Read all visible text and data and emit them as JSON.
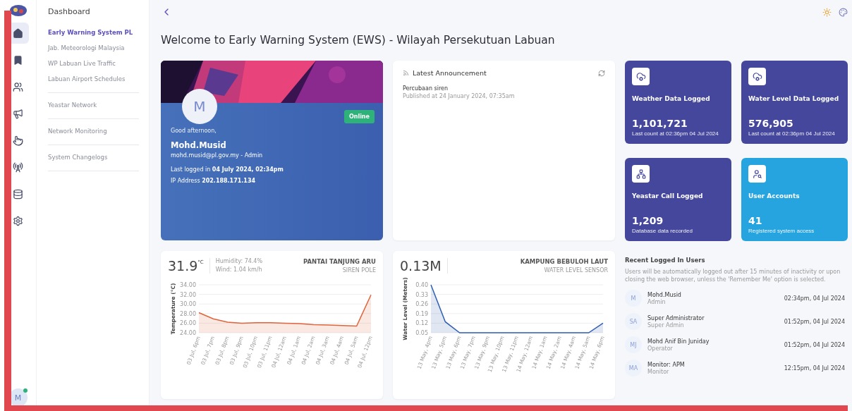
{
  "rail": {
    "items": [
      {
        "kind": "home",
        "selected": true
      },
      {
        "kind": "bookmark",
        "selected": false
      },
      {
        "kind": "users",
        "selected": false
      },
      {
        "kind": "megaphone",
        "selected": false
      },
      {
        "kind": "touch",
        "selected": false
      },
      {
        "kind": "antenna",
        "selected": false
      },
      {
        "kind": "database",
        "selected": false
      },
      {
        "kind": "settings",
        "selected": false
      }
    ],
    "avatar": {
      "initial": "M",
      "online": true
    }
  },
  "submenu": {
    "title": "Dashboard",
    "sections": [
      {
        "items": [
          {
            "label": "Early Warning System PL",
            "selected": true
          },
          {
            "label": "Jab. Meteorologi Malaysia",
            "selected": false
          },
          {
            "label": "WP Labuan Live Traffic",
            "selected": false
          },
          {
            "label": "Labuan Airport Schedules",
            "selected": false
          }
        ]
      },
      {
        "items": [
          {
            "label": "Yeastar Network",
            "selected": false
          }
        ]
      },
      {
        "items": [
          {
            "label": "Network Monitoring",
            "selected": false
          }
        ]
      },
      {
        "items": [
          {
            "label": "System Changelogs",
            "selected": false
          }
        ]
      }
    ]
  },
  "page_title": "Welcome to Early Warning System (EWS) - Wilayah Persekutuan Labuan",
  "profile": {
    "avatar_initial": "M",
    "status": "Online",
    "greeting": "Good afternoon,",
    "name": "Mohd.Musid",
    "email_role": "mohd.musid@pl.gov.my - Admin",
    "last_login": "Last logged in **04 July 2024, 02:34pm**",
    "ip": "IP Address **202.188.171.134**"
  },
  "announcement": {
    "title": "Latest Announcement",
    "items": [
      {
        "title": "Percubaan siren",
        "published": "Published at 24 January 2024, 07:35am"
      }
    ]
  },
  "stats": [
    {
      "kind": "cloud",
      "color": "#44479c",
      "label": "Weather Data Logged",
      "value": "1,101,721",
      "note": "Last count at 02:36pm 04 Jul 2024"
    },
    {
      "kind": "cloud",
      "color": "#44479c",
      "label": "Water Level Data Logged",
      "value": "576,905",
      "note": "Last count at 02:36pm 04 Jul 2024"
    },
    {
      "kind": "network",
      "color": "#44479c",
      "label": "Yeastar Call Logged",
      "value": "1,209",
      "note": "Database data recorded"
    },
    {
      "kind": "user",
      "color": "#26a4e0",
      "label": "User Accounts",
      "value": "41",
      "note": "Registered system access"
    }
  ],
  "weather": {
    "reading": "31.9",
    "unit": "°C",
    "humidity": "Humidity: 74.4%",
    "wind": "Wind: 1.04 km/h",
    "station": "PANTAI TANJUNG ARU",
    "type": "SIREN POLE",
    "chart_data": {
      "type": "area",
      "ylabel": "Temperature (°C)",
      "categories": [
        "03 Jul, 6pm",
        "03 Jul, 7pm",
        "03 Jul, 8pm",
        "03 Jul, 9pm",
        "03 Jul, 10pm",
        "03 Jul, 11pm",
        "04 Jul, 12am",
        "04 Jul, 1am",
        "04 Jul, 2am",
        "04 Jul, 3am",
        "04 Jul, 4am",
        "04 Jul, 5am",
        "04 Jul, 12pm"
      ],
      "grid": true,
      "series": [
        {
          "color": "#e0643c",
          "values": [
            28.2,
            26.9,
            26.2,
            26.0,
            26.1,
            26.1,
            26.0,
            25.9,
            25.7,
            25.6,
            25.5,
            25.4,
            31.9
          ]
        }
      ],
      "ylim": [
        24,
        34
      ],
      "yticks": [
        {
          "value": 24,
          "label": "24.00"
        },
        {
          "value": 26,
          "label": "26.00"
        },
        {
          "value": 28,
          "label": "28.00"
        },
        {
          "value": 30,
          "label": "30.00"
        },
        {
          "value": 32,
          "label": "32.00"
        },
        {
          "value": 34,
          "label": "34.00"
        }
      ]
    }
  },
  "water": {
    "reading": "0.13M",
    "station": "KAMPUNG BEBULOH LAUT",
    "type": "WATER LEVEL SENSOR",
    "chart_data": {
      "type": "area",
      "ylabel": "Water Level (Meters)",
      "categories": [
        "13 May, 4pm",
        "13 May, 5pm",
        "13 May, 6pm",
        "13 May, 7pm",
        "13 May, 9pm",
        "13 May, 10pm",
        "13 May, 11pm",
        "14 May, 12am",
        "14 May, 1am",
        "14 May, 2am",
        "14 May, 4am",
        "14 May, 5am",
        "14 May, 6pm"
      ],
      "grid": true,
      "series": [
        {
          "color": "#2f5fb0",
          "values": [
            0.4,
            0.13,
            0.05,
            0.05,
            0.05,
            0.05,
            0.05,
            0.05,
            0.05,
            0.05,
            0.05,
            0.05,
            0.12
          ]
        }
      ],
      "ylim": [
        0.05,
        0.4
      ],
      "yticks": [
        {
          "value": 0.05,
          "label": "0.05"
        },
        {
          "value": 0.12,
          "label": "0.12"
        },
        {
          "value": 0.19,
          "label": "0.19"
        },
        {
          "value": 0.26,
          "label": "0.26"
        },
        {
          "value": 0.33,
          "label": "0.33"
        },
        {
          "value": 0.4,
          "label": "0.40"
        }
      ]
    }
  },
  "recent_users": {
    "title": "Recent Logged In Users",
    "note": "Users will be automatically logged out after 15 minutes of inactivity or upon closing the web browser, unless the 'Remember Me' option is selected.",
    "users": [
      {
        "initials": "M",
        "name": "Mohd.Musid",
        "role": "Admin",
        "time": "02:34pm, 04 Jul 2024"
      },
      {
        "initials": "SA",
        "name": "Super Administrator",
        "role": "Super Admin",
        "time": "01:52pm, 04 Jul 2024"
      },
      {
        "initials": "MJ",
        "name": "Mohd Anif Bin Juniday",
        "role": "Operator",
        "time": "01:52pm, 04 Jul 2024"
      },
      {
        "initials": "MA",
        "name": "Monitor: APM",
        "role": "Monitor",
        "time": "12:15pm, 04 Jul 2024"
      }
    ]
  }
}
